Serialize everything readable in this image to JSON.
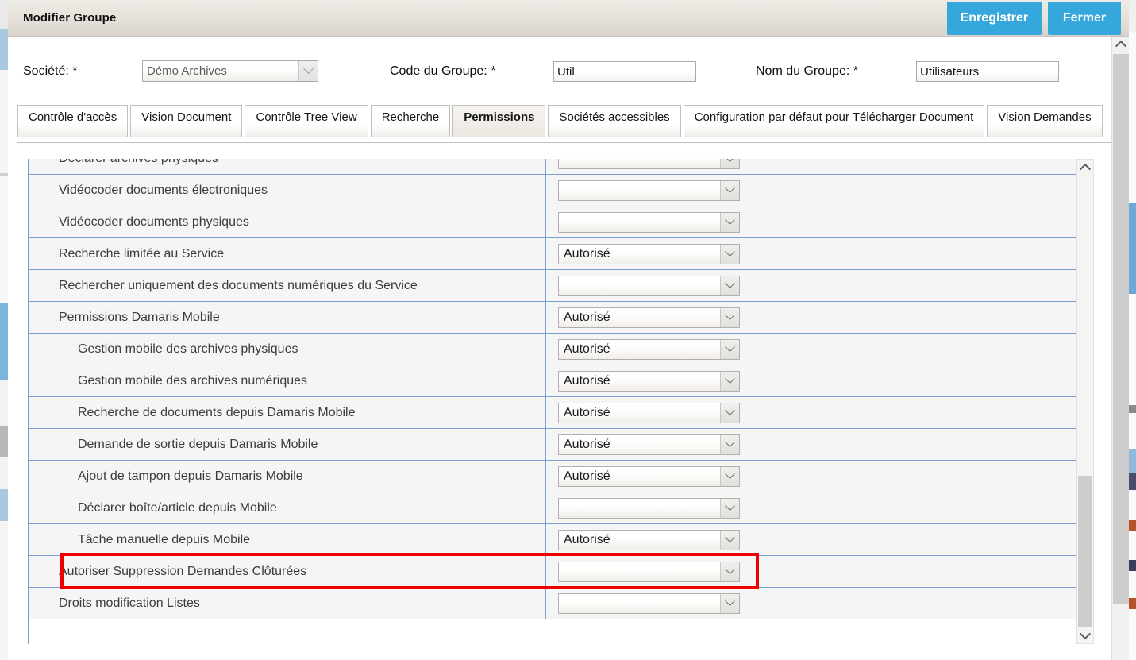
{
  "window": {
    "title": "Modifier Groupe",
    "accent_color": "#35a7dc",
    "buttons": [
      {
        "label": "Enregistrer",
        "name": "save-button"
      },
      {
        "label": "Fermer",
        "name": "close-button"
      }
    ]
  },
  "form": {
    "societe": {
      "label": "Société: *",
      "value": "Démo Archives",
      "disabled": true
    },
    "code_groupe": {
      "label": "Code du Groupe: *",
      "value": "Util"
    },
    "nom_groupe": {
      "label": "Nom du Groupe: *",
      "value": "Utilisateurs"
    }
  },
  "tabs": {
    "active": "Permissions",
    "items": [
      {
        "label": "Contrôle d'accès",
        "active": false
      },
      {
        "label": "Vision Document",
        "active": false
      },
      {
        "label": "Contrôle Tree View",
        "active": false
      },
      {
        "label": "Recherche",
        "active": false
      },
      {
        "label": "Permissions",
        "active": true
      },
      {
        "label": "Sociétés accessibles",
        "active": false
      },
      {
        "label": "Configuration par défaut pour Télécharger Document",
        "active": false
      },
      {
        "label": "Vision Demandes",
        "active": false
      }
    ]
  },
  "permissions": {
    "highlighted_row": "Tâche manuelle depuis Mobile",
    "highlight_color": "#ee0000",
    "rows": [
      {
        "label": "Déclarer archives physiques",
        "value": "",
        "indent": false
      },
      {
        "label": "Vidéocoder documents électroniques",
        "value": "",
        "indent": false
      },
      {
        "label": "Vidéocoder documents physiques",
        "value": "",
        "indent": false
      },
      {
        "label": "Recherche limitée au Service",
        "value": "Autorisé",
        "indent": false
      },
      {
        "label": "Rechercher uniquement des documents numériques du Service",
        "value": "",
        "indent": false
      },
      {
        "label": "Permissions Damaris Mobile",
        "value": "Autorisé",
        "indent": false
      },
      {
        "label": "Gestion mobile des archives physiques",
        "value": "Autorisé",
        "indent": true
      },
      {
        "label": "Gestion mobile des archives numériques",
        "value": "Autorisé",
        "indent": true
      },
      {
        "label": "Recherche de documents depuis Damaris Mobile",
        "value": "Autorisé",
        "indent": true
      },
      {
        "label": "Demande de sortie depuis Damaris Mobile",
        "value": "Autorisé",
        "indent": true
      },
      {
        "label": "Ajout de tampon depuis Damaris Mobile",
        "value": "Autorisé",
        "indent": true
      },
      {
        "label": "Déclarer boîte/article depuis Mobile",
        "value": "",
        "indent": true
      },
      {
        "label": "Tâche manuelle depuis Mobile",
        "value": "Autorisé",
        "indent": true
      },
      {
        "label": "Autoriser Suppression Demandes Clôturées",
        "value": "",
        "indent": false
      },
      {
        "label": "Droits modification Listes",
        "value": "",
        "indent": false
      }
    ]
  },
  "scrollbars": {
    "grid": {
      "up_icon": "chevron-up-icon",
      "down_icon": "chevron-down-icon"
    },
    "page": {
      "up_icon": "chevron-up-icon"
    }
  }
}
